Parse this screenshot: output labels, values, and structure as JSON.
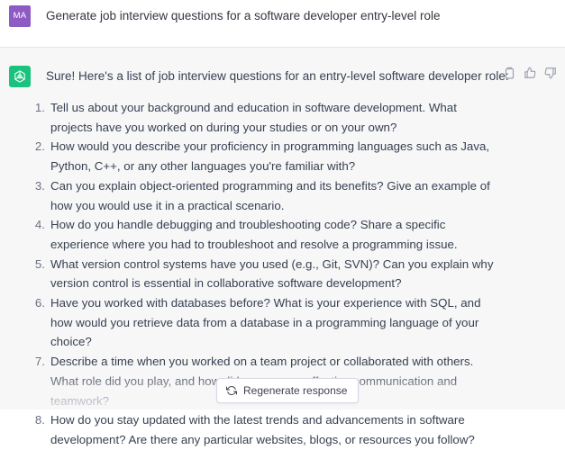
{
  "user": {
    "avatar_initials": "MA",
    "message": "Generate job interview questions for a software developer entry-level role"
  },
  "assistant": {
    "avatar_icon": "openai-logo-icon",
    "intro": "Sure! Here's a list of job interview questions for an entry-level software developer role:",
    "actions": [
      "copy-icon",
      "thumbs-up-icon",
      "thumbs-down-icon"
    ],
    "questions": [
      {
        "num": "1.",
        "text": "Tell us about your background and education in software development. What projects have you worked on during your studies or on your own?"
      },
      {
        "num": "2.",
        "text": "How would you describe your proficiency in programming languages such as Java, Python, C++, or any other languages you're familiar with?"
      },
      {
        "num": "3.",
        "text": "Can you explain object-oriented programming and its benefits? Give an example of how you would use it in a practical scenario."
      },
      {
        "num": "4.",
        "text": "How do you handle debugging and troubleshooting code? Share a specific experience where you had to troubleshoot and resolve a programming issue."
      },
      {
        "num": "5.",
        "text": "What version control systems have you used (e.g., Git, SVN)? Can you explain why version control is essential in collaborative software development?"
      },
      {
        "num": "6.",
        "text": "Have you worked with databases before? What is your experience with SQL, and how would you retrieve data from a database in a programming language of your choice?"
      },
      {
        "num": "7.",
        "text": "Describe a time when you worked on a team project or collaborated with others. What role did you play, and how did you ensure effective communication and teamwork?"
      },
      {
        "num": "8.",
        "text": "How do you stay updated with the latest trends and advancements in software development? Are there any particular websites, blogs, or resources you follow?"
      }
    ]
  },
  "regenerate": {
    "label": "Regenerate response",
    "icon": "refresh-icon"
  },
  "colors": {
    "user_avatar": "#8e5bc4",
    "assistant_avatar": "#19c37d",
    "assistant_bg": "#f7f7f8",
    "text": "#374151"
  }
}
